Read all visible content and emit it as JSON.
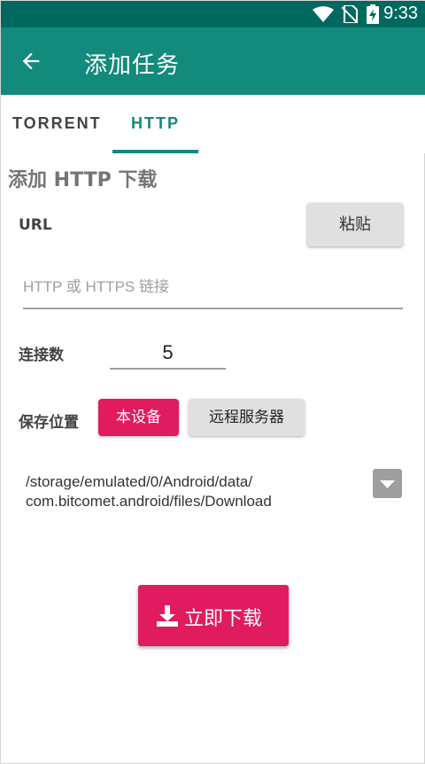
{
  "status_bar": {
    "time": "9:33",
    "icons": [
      "wifi-icon",
      "no-sim-icon",
      "battery-charging-icon"
    ]
  },
  "app_bar": {
    "title": "添加任务",
    "back_icon": "arrow-left-icon"
  },
  "tabs": [
    {
      "label": "TORRENT",
      "active": false
    },
    {
      "label": "HTTP",
      "active": true
    }
  ],
  "form": {
    "section_title": "添加 HTTP 下载",
    "url_label": "URL",
    "paste_label": "粘贴",
    "url_placeholder": "HTTP 或 HTTPS 链接",
    "url_value": "",
    "connections_label": "连接数",
    "connections_value": "5",
    "save_location_label": "保存位置",
    "location_options": [
      {
        "label": "本设备",
        "selected": true
      },
      {
        "label": "远程服务器",
        "selected": false
      }
    ],
    "path_line1": "/storage/emulated/0/Android/data/",
    "path_line2": "com.bitcomet.android/files/Download",
    "download_label": "立即下载",
    "download_icon": "download-icon"
  },
  "colors": {
    "status_bar": "#00695f",
    "app_bar": "#128a7c",
    "accent": "#e01b60",
    "tab_active": "#128a7c"
  }
}
